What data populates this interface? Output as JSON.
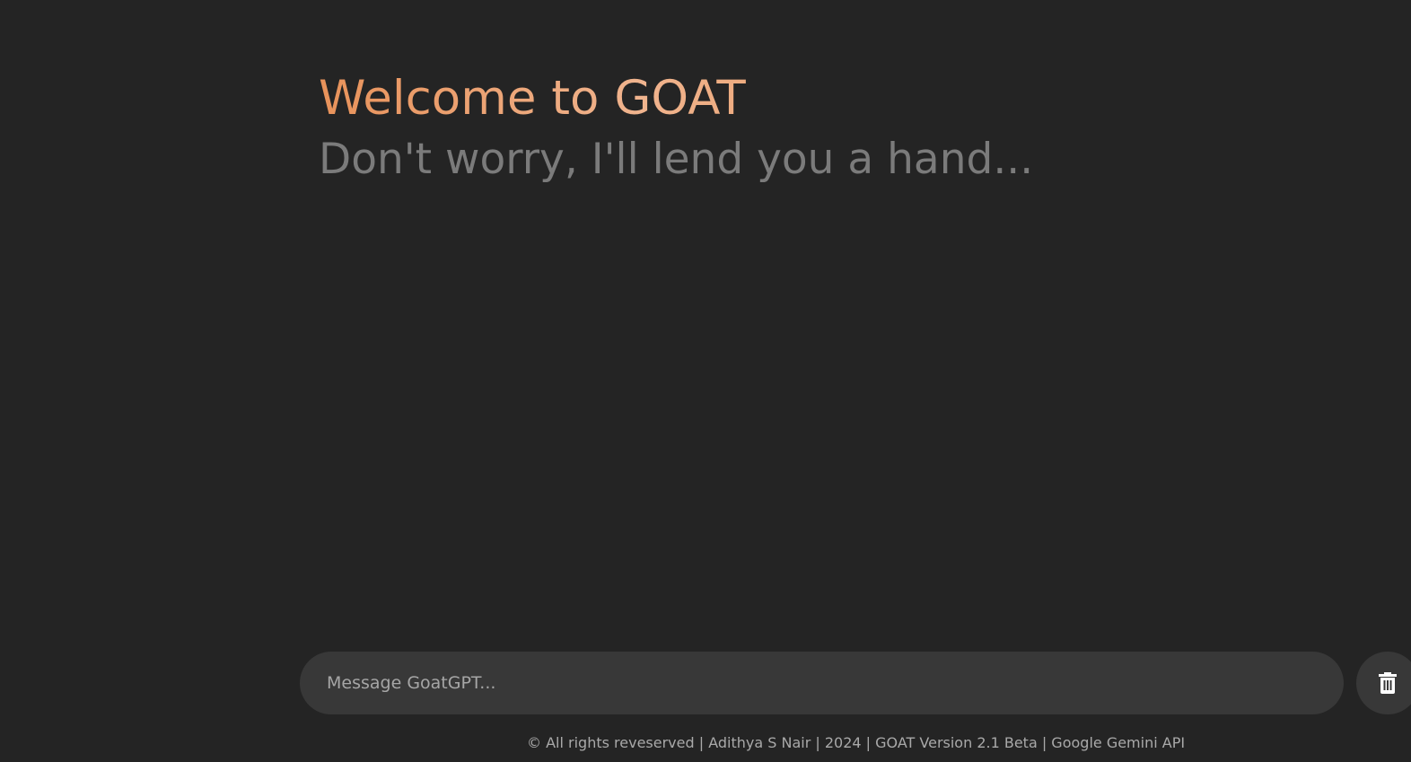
{
  "header": {
    "title": "Welcome to GOAT",
    "subtitle": "Don't worry, I'll lend you a hand..."
  },
  "composer": {
    "placeholder": "Message GoatGPT...",
    "value": "",
    "delete_icon": "trash-icon"
  },
  "footer": {
    "text": "© All rights reveserved | Adithya S Nair | 2024 | GOAT Version 2.1 Beta | Google Gemini API"
  },
  "colors": {
    "background": "#242424",
    "title_gradient_start": "#e8925a",
    "title_gradient_mid": "#f0b48e",
    "subtitle": "#7b7b7b",
    "input_background": "#383838",
    "footer_text": "#a9a9a9"
  }
}
